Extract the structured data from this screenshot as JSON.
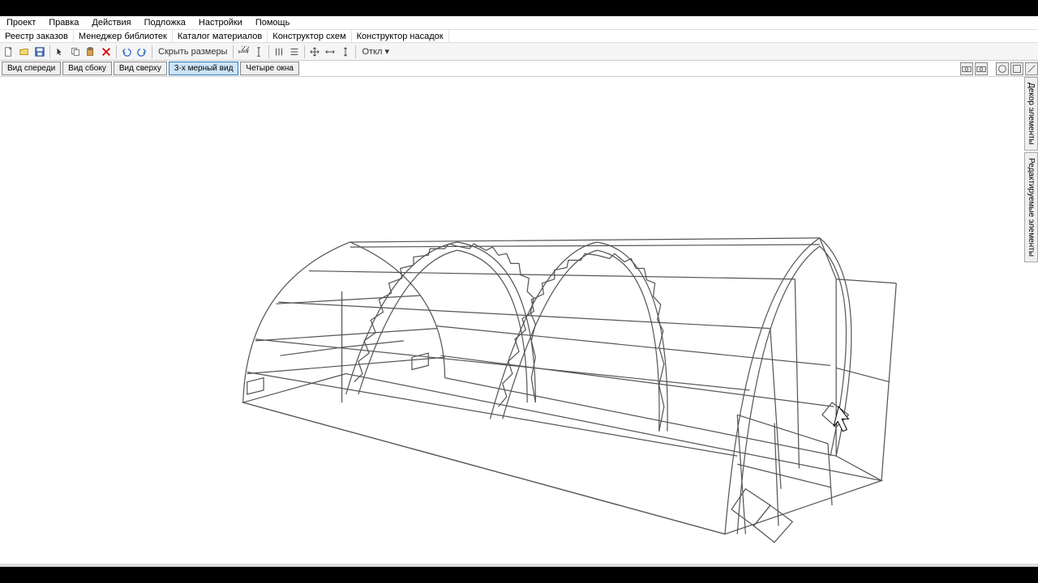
{
  "menubar": {
    "project": "Проект",
    "edit": "Правка",
    "actions": "Действия",
    "underlay": "Подложка",
    "settings": "Настройки",
    "help": "Помощь"
  },
  "subbar": {
    "order_registry": "Реестр заказов",
    "library_manager": "Менеджер библиотек",
    "material_catalog": "Каталог материалов",
    "schema_constructor": "Конструктор схем",
    "nozzle_constructor": "Конструктор насадок"
  },
  "toolbar": {
    "hide_dimensions": "Скрыть размеры",
    "snap_label": "Откл"
  },
  "viewbar": {
    "front": "Вид спереди",
    "side": "Вид сбоку",
    "top": "Вид сверху",
    "d3": "3-х мерный вид",
    "four": "Четыре окна"
  },
  "side_tabs": {
    "decor": "Декор элементы",
    "edit_elements": "Редактируемые элементы"
  }
}
